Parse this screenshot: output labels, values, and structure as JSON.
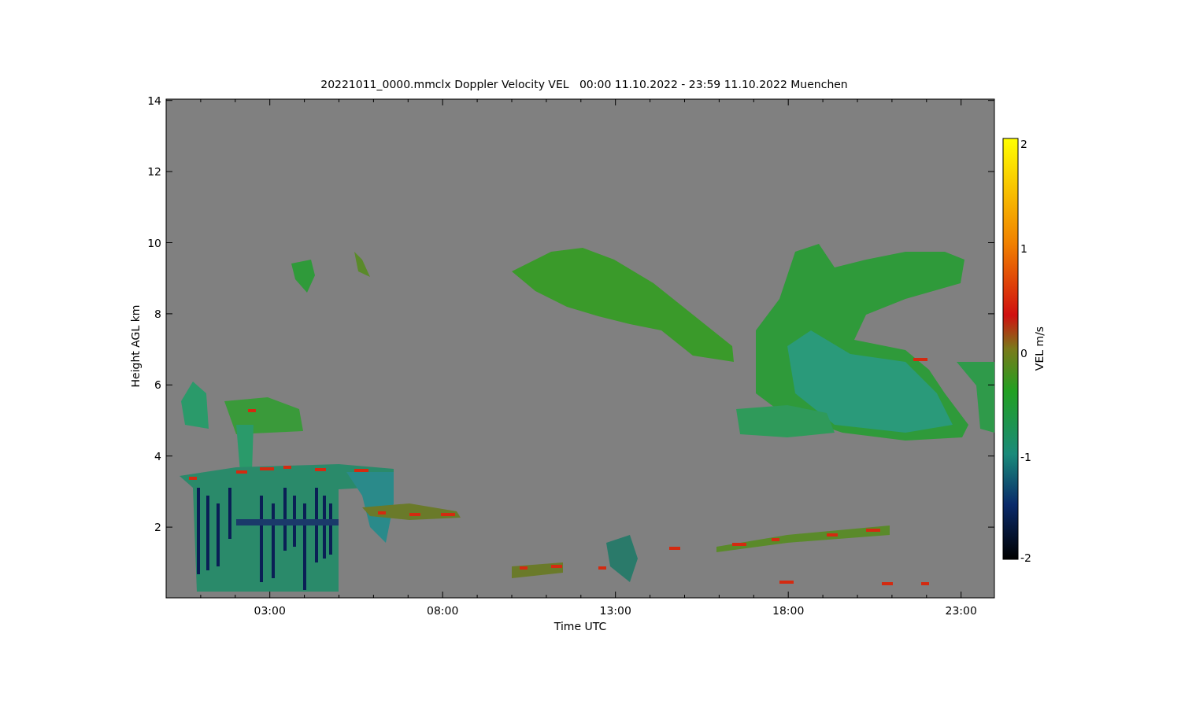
{
  "title": "20221011_0000.mmclx Doppler Velocity VEL   00:00 11.10.2022 - 23:59 11.10.2022 Muenchen",
  "plot": {
    "ylabel": "Height AGL km",
    "xlabel": "Time UTC",
    "yticks": [
      "14",
      "12",
      "10",
      "8",
      "6",
      "4",
      "2"
    ],
    "xticks": [
      "03:00",
      "08:00",
      "13:00",
      "18:00",
      "23:00"
    ]
  },
  "colorbar": {
    "label": "VEL m/s",
    "ticks": [
      "2",
      "1",
      "0",
      "-1",
      "-2"
    ]
  }
}
